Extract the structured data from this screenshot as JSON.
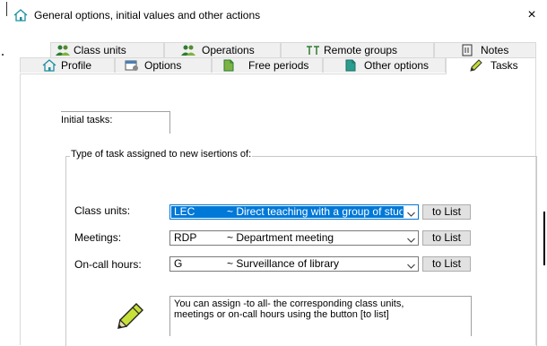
{
  "window": {
    "title": "General options, initial values and other actions",
    "close_symbol": "×"
  },
  "tabs": {
    "row1": [
      {
        "label": "Class units",
        "icon": "class-units-icon"
      },
      {
        "label": "Operations",
        "icon": "operations-icon"
      },
      {
        "label": "Remote groups",
        "icon": "remote-groups-icon"
      },
      {
        "label": "Notes",
        "icon": "notes-icon"
      }
    ],
    "row2": [
      {
        "label": "Profile",
        "icon": "profile-icon"
      },
      {
        "label": "Options",
        "icon": "options-icon"
      },
      {
        "label": "Free periods",
        "icon": "free-periods-icon"
      },
      {
        "label": "Other options",
        "icon": "other-options-icon"
      },
      {
        "label": "Tasks",
        "icon": "tasks-icon",
        "active": true
      }
    ]
  },
  "content": {
    "initial_tasks_label": "Initial tasks:",
    "group_title": "Type of task assigned to new isertions of:",
    "rows": [
      {
        "label": "Class units:",
        "code": "LEC",
        "description": "~ Direct teaching with a group of stuc",
        "focused": true,
        "button": "to List"
      },
      {
        "label": "Meetings:",
        "code": "RDP",
        "description": "~ Department meeting",
        "focused": false,
        "button": "to List"
      },
      {
        "label": "On-call hours:",
        "code": "G",
        "description": "~ Surveillance of library",
        "focused": false,
        "button": "to List"
      }
    ],
    "info_line1": "You can assign -to all- the corresponding class units,",
    "info_line2": "meetings or on-call hours using the button [to list]"
  },
  "colors": {
    "selection": "#0078d7",
    "tab_background": "#f0f0f0",
    "button_face": "#e1e1e1"
  }
}
